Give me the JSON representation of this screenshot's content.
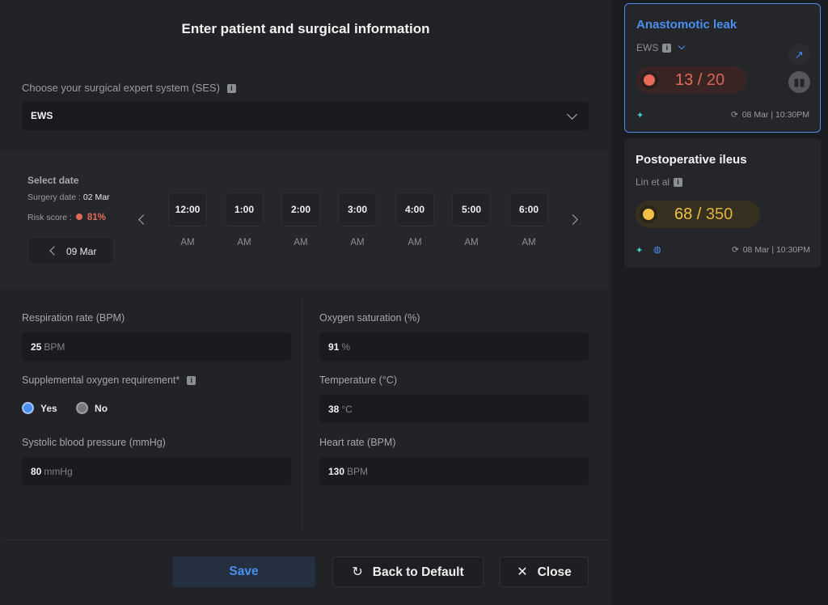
{
  "form": {
    "title": "Enter patient and surgical information",
    "ses_label": "Choose your surgical expert system (SES)",
    "ses_value": "EWS",
    "date": {
      "title": "Select date",
      "surgery_date_label": "Surgery date :",
      "surgery_date_value": "02 Mar",
      "risk_label": "Risk score :",
      "risk_value": "81%",
      "selected_date": "09 Mar"
    },
    "time_slots": [
      {
        "time": "12:00",
        "ampm": "AM"
      },
      {
        "time": "1:00",
        "ampm": "AM"
      },
      {
        "time": "2:00",
        "ampm": "AM"
      },
      {
        "time": "3:00",
        "ampm": "AM"
      },
      {
        "time": "4:00",
        "ampm": "AM"
      },
      {
        "time": "5:00",
        "ampm": "AM"
      },
      {
        "time": "6:00",
        "ampm": "AM"
      }
    ],
    "fields": {
      "respiration": {
        "label": "Respiration rate (BPM)",
        "value": "25",
        "unit": "BPM"
      },
      "oxygen_sat": {
        "label": "Oxygen saturation (%)",
        "value": "91",
        "unit": "%"
      },
      "supplemental": {
        "label": "Supplemental oxygen requirement*",
        "yes": "Yes",
        "no": "No"
      },
      "temperature": {
        "label": "Temperature (°C)",
        "value": "38",
        "unit": "°C"
      },
      "systolic": {
        "label": "Systolic blood pressure (mmHg)",
        "value": "80",
        "unit": "mmHg"
      },
      "heart_rate": {
        "label": "Heart rate (BPM)",
        "value": "130",
        "unit": "BPM"
      }
    },
    "buttons": {
      "save": "Save",
      "default": "Back to Default",
      "close": "Close"
    }
  },
  "cards": [
    {
      "title": "Anastomotic leak",
      "subtitle": "EWS",
      "score": "13",
      "max": "20",
      "timestamp": "08 Mar | 10:30PM",
      "status_color": "#e7695a"
    },
    {
      "title": "Postoperative ileus",
      "subtitle": "Lin et al",
      "score": "68",
      "max": "350",
      "timestamp": "08 Mar | 10:30PM",
      "status_color": "#f2c046"
    }
  ],
  "icons": {
    "info": "info-icon",
    "chevron": "chevron-down-icon",
    "trend": "trend-up-icon",
    "book": "book-icon",
    "sparkle": "sparkle-icon",
    "brain": "brain-icon",
    "sync": "sync-icon",
    "refresh": "refresh-icon",
    "close": "close-icon"
  },
  "colors": {
    "accent": "#4a8ef0",
    "risk_red": "#e7695a",
    "warn_yellow": "#f2c046",
    "background": "#1b1c1f"
  }
}
